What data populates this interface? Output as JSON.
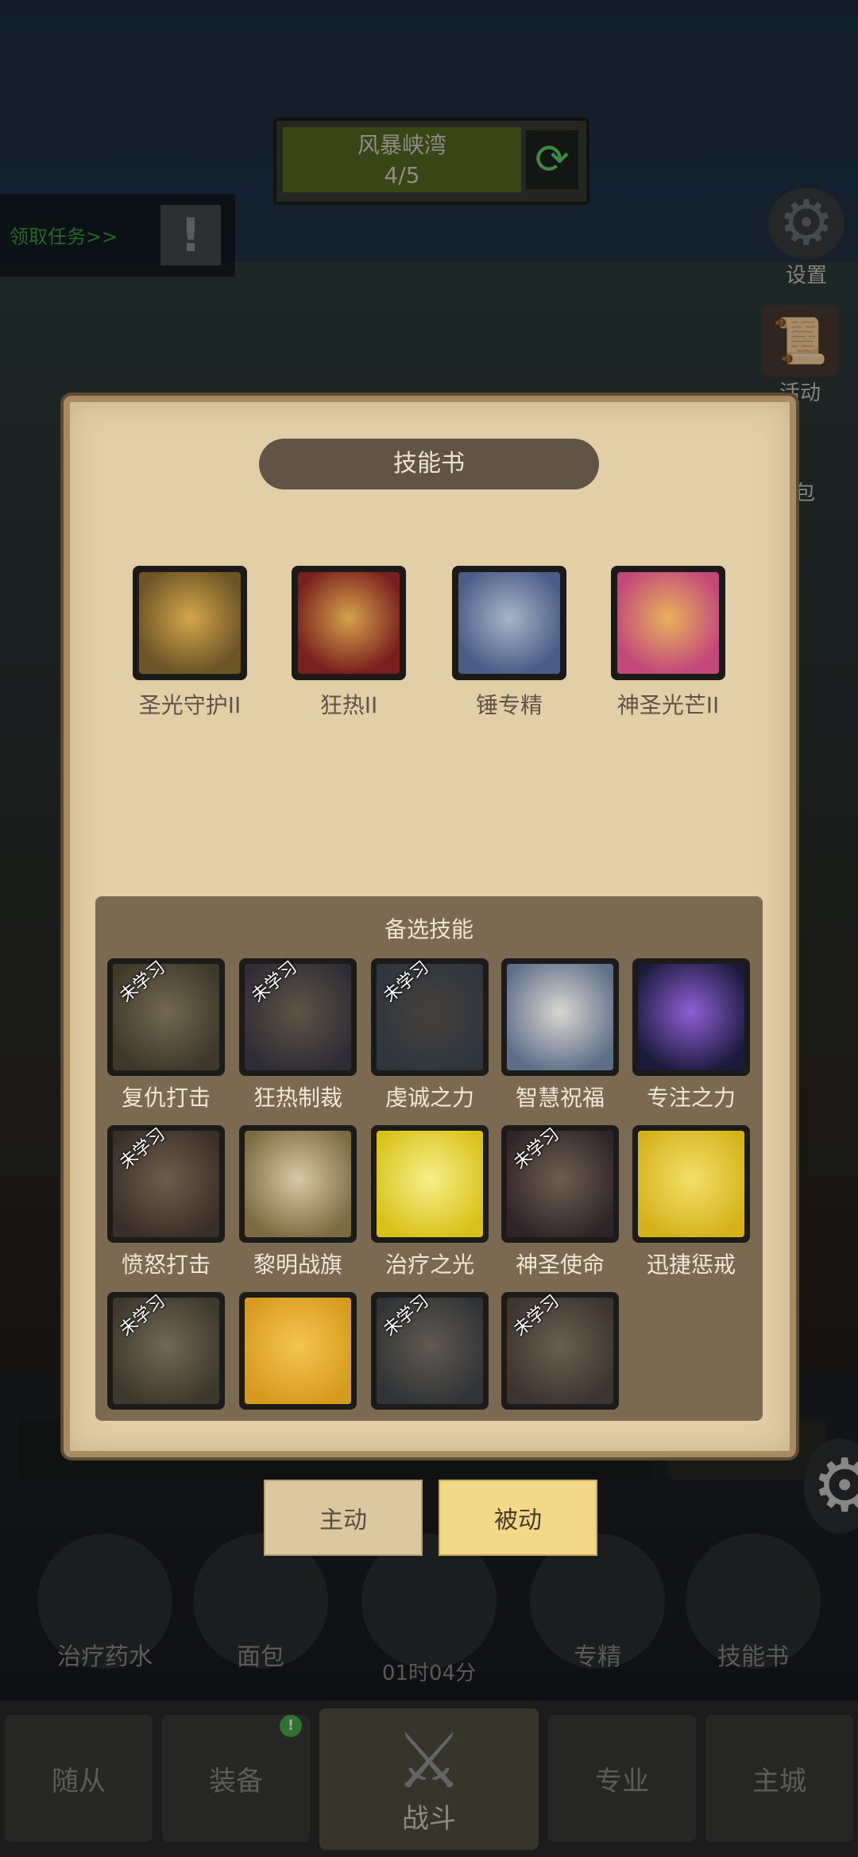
{
  "region": {
    "name": "风暴峡湾",
    "progress": "4/5"
  },
  "quest": {
    "label": "领取任务>>",
    "alert": "!"
  },
  "side": {
    "settings": "设置",
    "activity": "活动",
    "bag_partial": "包"
  },
  "panel": {
    "title": "技能书",
    "equipped": [
      {
        "label": "圣光守护II",
        "colors": [
          "#6b5426",
          "#d3a64a"
        ]
      },
      {
        "label": "狂热II",
        "colors": [
          "#7a1f1f",
          "#d4a24a"
        ]
      },
      {
        "label": "锤专精",
        "colors": [
          "#4b5d86",
          "#a8b4c8"
        ]
      },
      {
        "label": "神圣光芒II",
        "colors": [
          "#c2487a",
          "#e8b25b"
        ]
      }
    ],
    "alternates_title": "备选技能",
    "unlearned_tag": "未学习",
    "alternates": [
      {
        "label": "复仇打击",
        "unlearned": true,
        "colors": [
          "#5a4a22",
          "#a98a45"
        ]
      },
      {
        "label": "狂热制裁",
        "unlearned": true,
        "colors": [
          "#3f3a55",
          "#8f6c3e"
        ]
      },
      {
        "label": "虔诚之力",
        "unlearned": true,
        "colors": [
          "#2f4a66",
          "#6b5340"
        ]
      },
      {
        "label": "智慧祝福",
        "unlearned": false,
        "colors": [
          "#5d6e88",
          "#d9d6d0"
        ]
      },
      {
        "label": "专注之力",
        "unlearned": false,
        "colors": [
          "#1a1a3a",
          "#8e5fd6"
        ]
      },
      {
        "label": "愤怒打击",
        "unlearned": true,
        "colors": [
          "#5d3b26",
          "#a47a48"
        ]
      },
      {
        "label": "黎明战旗",
        "unlearned": false,
        "colors": [
          "#7b6b40",
          "#d7c9a6"
        ]
      },
      {
        "label": "治疗之光",
        "unlearned": false,
        "colors": [
          "#d8c21a",
          "#f7ef8a"
        ]
      },
      {
        "label": "神圣使命",
        "unlearned": true,
        "colors": [
          "#4a2e3a",
          "#a67a4a"
        ]
      },
      {
        "label": "迅捷惩戒",
        "unlearned": false,
        "colors": [
          "#d5b21a",
          "#f2e06a"
        ]
      },
      {
        "label": "",
        "unlearned": true,
        "colors": [
          "#5a4a26",
          "#a48b50"
        ]
      },
      {
        "label": "",
        "unlearned": false,
        "colors": [
          "#d69a1e",
          "#f3c550"
        ]
      },
      {
        "label": "",
        "unlearned": true,
        "colors": [
          "#3c4550",
          "#8a7656"
        ]
      },
      {
        "label": "",
        "unlearned": true,
        "colors": [
          "#5a4430",
          "#9b7b52"
        ]
      }
    ],
    "tab_active": "主动",
    "tab_passive": "被动"
  },
  "hud": {
    "potion": "治疗药水",
    "bread": "面包",
    "specialty": "专精",
    "skillbook": "技能书",
    "timer": "01时04分"
  },
  "nav": {
    "followers": "随从",
    "equipment": "装备",
    "battle": "战斗",
    "profession": "专业",
    "main_city": "主城",
    "badge": "!"
  }
}
